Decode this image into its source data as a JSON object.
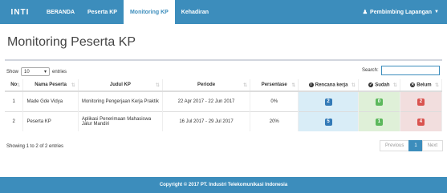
{
  "navbar": {
    "logo_text": "INTI",
    "items": [
      {
        "label": "BERANDA"
      },
      {
        "label": "Peserta KP"
      },
      {
        "label": "Monitoring KP"
      },
      {
        "label": "Kehadiran"
      }
    ],
    "user_label": "Pembimbing Lapangan"
  },
  "page": {
    "title": "Monitoring Peserta KP"
  },
  "length_control": {
    "show_label": "Show",
    "value": "10",
    "entries_label": "entries"
  },
  "search": {
    "label": "Search:",
    "value": ""
  },
  "table": {
    "headers": [
      "No",
      "Nama Peserta",
      "Judul KP",
      "Periode",
      "Persentase",
      "Rencana kerja",
      "Sudah",
      "Belum"
    ],
    "rows": [
      {
        "no": "1",
        "nama": "Made Gde Vidya",
        "judul": "Monitoring Pengerjaan Kerja Praktik",
        "periode": "22 Apr 2017 - 22 Jun 2017",
        "persentase": "0%",
        "rencana": "2",
        "sudah": "0",
        "belum": "2"
      },
      {
        "no": "2",
        "nama": "Peserta KP",
        "judul": "Aplikasi Penerimaan Mahasiswa Jalur Mandiri",
        "periode": "16 Jul 2017 - 29 Jul 2017",
        "persentase": "20%",
        "rencana": "5",
        "sudah": "1",
        "belum": "4"
      }
    ]
  },
  "info": {
    "text": "Showing 1 to 2 of 2 entries"
  },
  "pagination": {
    "previous": "Previous",
    "current": "1",
    "next": "Next"
  },
  "footer": {
    "text": "Copyright © 2017 PT. Industri Telekomunikasi Indonesia"
  },
  "colors": {
    "primary": "#3c8dbc",
    "info": "#337ab7",
    "success": "#5cb85c",
    "danger": "#d9534f"
  }
}
